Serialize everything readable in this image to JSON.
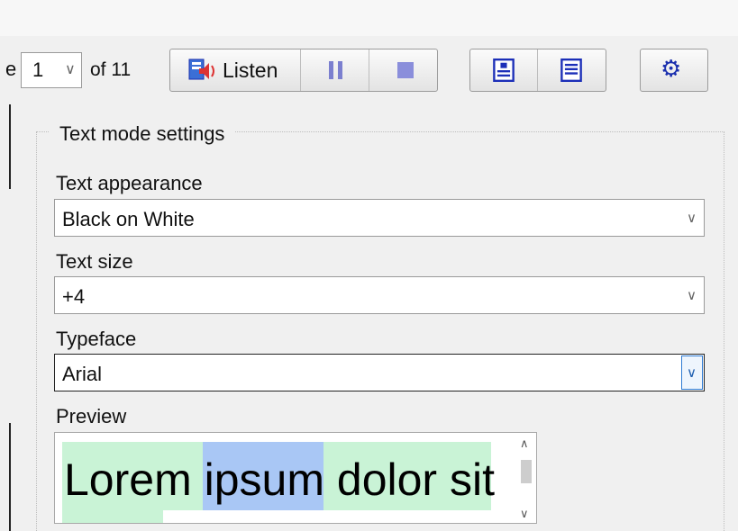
{
  "toolbar": {
    "page_prefix": "e",
    "page_value": "1",
    "page_of": "of 11",
    "listen_label": "Listen",
    "icons": [
      "speaker-icon",
      "pause-icon",
      "stop-icon",
      "doc-icon",
      "doc-lines-icon",
      "gear-icon"
    ]
  },
  "settings": {
    "group_title": "Text mode settings",
    "text_appearance": {
      "label": "Text appearance",
      "value": "Black on White"
    },
    "text_size": {
      "label": "Text size",
      "value": "+4"
    },
    "typeface": {
      "label": "Typeface",
      "value": "Arial"
    },
    "preview": {
      "label": "Preview",
      "text": "Lorem ipsum dolor sit"
    }
  },
  "colors": {
    "highlight_word": "#a9c7f5",
    "highlight_sentence": "#c9f3d6",
    "icon_accent": "#1a2fae"
  }
}
